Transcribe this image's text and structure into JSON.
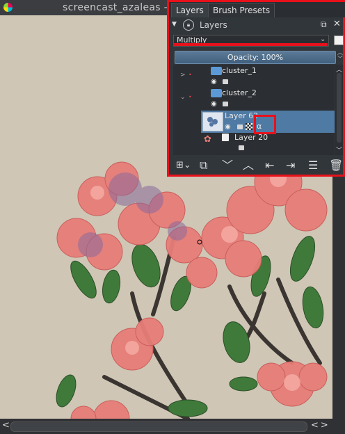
{
  "window": {
    "title": "screencast_azaleas - sc"
  },
  "docker": {
    "tabs": [
      {
        "label": "Layers",
        "accel": "a"
      },
      {
        "label": "Brush Presets",
        "accel": "B"
      }
    ],
    "header_title": "Layers",
    "blend_mode": "Multiply",
    "opacity_text": "Opacity:  100%",
    "layers": [
      {
        "name": "cluster_1",
        "type": "group"
      },
      {
        "name": "cluster_2",
        "type": "group"
      },
      {
        "name": "Layer 62",
        "type": "paint",
        "selected": true,
        "alpha_inherit": "α"
      },
      {
        "name": "Layer 20",
        "type": "paint"
      }
    ],
    "toolbar": [
      "add-layer",
      "duplicate",
      "move-down",
      "move-up",
      "indent",
      "outdent",
      "properties",
      "delete"
    ]
  },
  "colors": {
    "annotation": "#e8111b",
    "selection": "#4f7aa3",
    "canvas": "#cfc6b5"
  }
}
